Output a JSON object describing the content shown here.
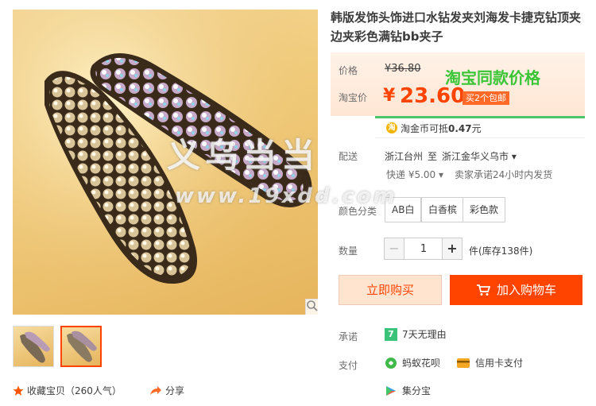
{
  "product": {
    "title": "韩版发饰头饰进口水钻发夹刘海发卡捷克钻顶夹边夹彩色满钻bb夹子"
  },
  "price": {
    "orig_label": "价格",
    "orig_price": "¥36.80",
    "tb_label": "淘宝价",
    "currency": "¥",
    "tb_price": "23.60",
    "promo_tag": "买2个包邮",
    "same_price_banner": "淘宝同款价格"
  },
  "coin": {
    "icon": "淘",
    "text_prefix": "淘金币可抵",
    "amount": "0.47",
    "text_suffix": "元"
  },
  "shipping": {
    "label": "配送",
    "from": "浙江台州",
    "to_word": "至",
    "to": "浙江金华义乌市",
    "method": "快递 ¥5.00",
    "promise": "卖家承诺24小时内发货"
  },
  "colors": {
    "label": "颜色分类",
    "options": [
      "AB白",
      "白香槟",
      "彩色款"
    ]
  },
  "quantity": {
    "label": "数量",
    "minus": "−",
    "value": "1",
    "plus": "+",
    "stock": "件(库存138件)"
  },
  "actions": {
    "buy_now": "立即购买",
    "add_cart": "加入购物车"
  },
  "service": {
    "promise_label": "承诺",
    "promise_icon": "7",
    "promise_text": "7天无理由",
    "pay_label": "支付",
    "huabei": "蚂蚁花呗",
    "credit": "信用卡支付",
    "jifen": "集分宝"
  },
  "gallery": {
    "favorite": "收藏宝贝（260人气）",
    "share": "分享"
  },
  "watermark": {
    "brand": "义乌当当",
    "url": "www.19xdd.com"
  },
  "colors_theme": {
    "accent": "#ff4400",
    "green": "#39c535"
  }
}
